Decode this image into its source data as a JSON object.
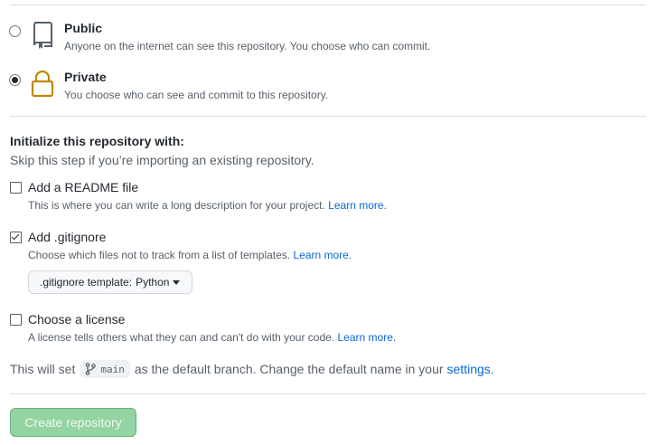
{
  "visibility": {
    "public": {
      "label": "Public",
      "description": "Anyone on the internet can see this repository. You choose who can commit.",
      "icon": "repo-icon",
      "selected": false
    },
    "private": {
      "label": "Private",
      "description": "You choose who can see and commit to this repository.",
      "icon": "lock-icon",
      "selected": true
    }
  },
  "init": {
    "title": "Initialize this repository with:",
    "description": "Skip this step if you’re importing an existing repository.",
    "readme": {
      "label": "Add a README file",
      "description": "This is where you can write a long description for your project.",
      "link": "Learn more.",
      "checked": false
    },
    "gitignore": {
      "label": "Add .gitignore",
      "description": "Choose which files not to track from a list of templates.",
      "link": "Learn more.",
      "checked": true,
      "template_prefix": ".gitignore template:",
      "template_value": "Python"
    },
    "license": {
      "label": "Choose a license",
      "description": "A license tells others what they can and can't do with your code.",
      "link": "Learn more.",
      "checked": false
    }
  },
  "branch": {
    "prefix": "This will set",
    "name": "main",
    "suffix": "as the default branch. Change the default name in your",
    "link": "settings",
    "end": "."
  },
  "submit": {
    "label": "Create repository",
    "disabled": true
  },
  "colors": {
    "link": "#0969da",
    "lock_icon": "#bf8700",
    "submit_bg": "#94d3a2"
  }
}
